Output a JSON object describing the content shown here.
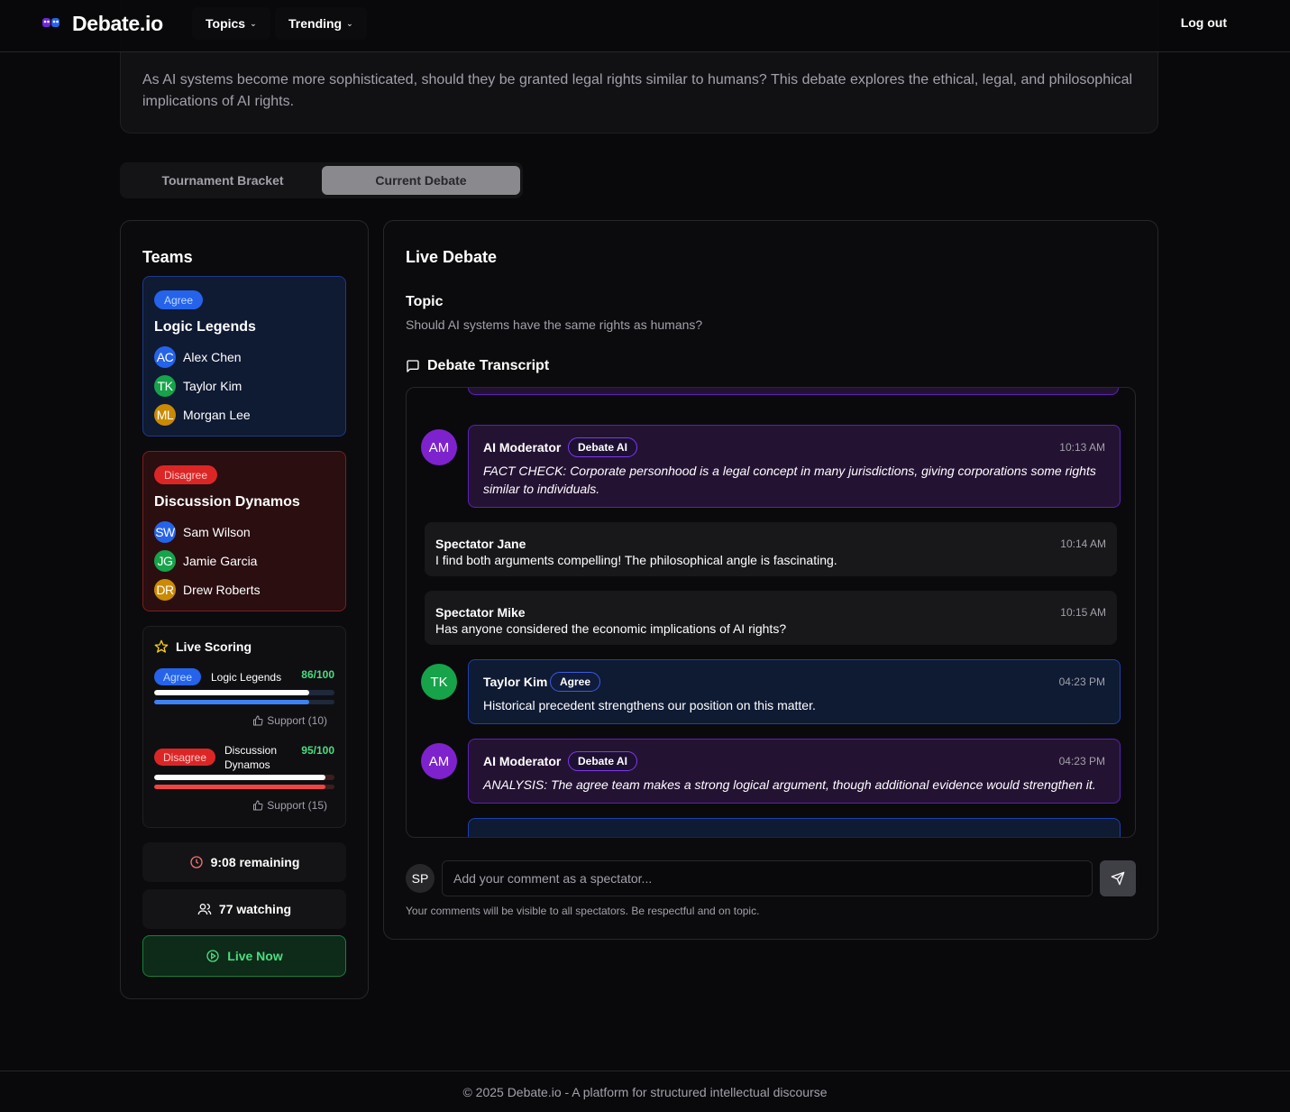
{
  "header": {
    "brand": "Debate.io",
    "nav": [
      {
        "label": "Topics"
      },
      {
        "label": "Trending"
      }
    ],
    "logout_label": "Log out"
  },
  "topic_card": {
    "description": "As AI systems become more sophisticated, should they be granted legal rights similar to humans? This debate explores the ethical, legal, and philosophical implications of AI rights."
  },
  "tabs": [
    {
      "label": "Tournament Bracket",
      "active": false
    },
    {
      "label": "Current Debate",
      "active": true
    }
  ],
  "teams_panel": {
    "title": "Teams",
    "teams": [
      {
        "side": "Agree",
        "name": "Logic Legends",
        "members": [
          {
            "initials": "AC",
            "name": "Alex Chen",
            "color": "#2563eb"
          },
          {
            "initials": "TK",
            "name": "Taylor Kim",
            "color": "#16a34a"
          },
          {
            "initials": "ML",
            "name": "Morgan Lee",
            "color": "#ca8a04"
          }
        ]
      },
      {
        "side": "Disagree",
        "name": "Discussion Dynamos",
        "members": [
          {
            "initials": "SW",
            "name": "Sam Wilson",
            "color": "#2563eb"
          },
          {
            "initials": "JG",
            "name": "Jamie Garcia",
            "color": "#16a34a"
          },
          {
            "initials": "DR",
            "name": "Drew Roberts",
            "color": "#ca8a04"
          }
        ]
      }
    ],
    "scoring": {
      "title": "Live Scoring",
      "rows": [
        {
          "side": "Agree",
          "team": "Logic Legends",
          "score": "86/100",
          "score_fraction": 0.86,
          "support_fraction": 0.86,
          "support": "Support (10)",
          "color": "#3b82f6"
        },
        {
          "side": "Disagree",
          "team_line1": "Discussion",
          "team_line2": "Dynamos",
          "score": "95/100",
          "score_fraction": 0.95,
          "support_fraction": 0.95,
          "support": "Support (15)",
          "color": "#ef4444"
        }
      ]
    },
    "timer": "9:08 remaining",
    "watching": "77 watching",
    "live": "Live Now"
  },
  "debate_panel": {
    "title": "Live Debate",
    "topic_label": "Topic",
    "topic": "Should AI systems have the same rights as humans?",
    "transcript_title": "Debate Transcript",
    "messages": [
      {
        "type": "ai",
        "initials": "AM",
        "author": "AI Moderator",
        "badge": "Debate AI",
        "time": "10:13 AM",
        "text": "FACT CHECK: Corporate personhood is a legal concept in many jurisdictions, giving corporations some rights similar to individuals."
      },
      {
        "type": "spectator",
        "author": "Spectator Jane",
        "time": "10:14 AM",
        "text": "I find both arguments compelling! The philosophical angle is fascinating."
      },
      {
        "type": "spectator",
        "author": "Spectator Mike",
        "time": "10:15 AM",
        "text": "Has anyone considered the economic implications of AI rights?"
      },
      {
        "type": "agree",
        "initials": "TK",
        "author": "Taylor Kim",
        "badge": "Agree",
        "time": "04:23 PM",
        "text": "Historical precedent strengthens our position on this matter."
      },
      {
        "type": "ai",
        "initials": "AM",
        "author": "AI Moderator",
        "badge": "Debate AI",
        "time": "04:23 PM",
        "text": "ANALYSIS: The agree team makes a strong logical argument, though additional evidence would strengthen it."
      }
    ],
    "comment": {
      "avatar": "SP",
      "placeholder": "Add your comment as a spectator...",
      "hint": "Your comments will be visible to all spectators. Be respectful and on topic."
    }
  },
  "footer": "© 2025 Debate.io - A platform for structured intellectual discourse",
  "colors": {
    "agree": "#2563eb",
    "disagree": "#dc2626",
    "ai": "#7c3aed",
    "live": "#4ade80"
  }
}
